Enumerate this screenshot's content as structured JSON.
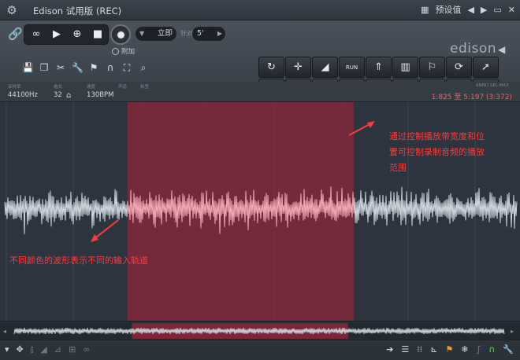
{
  "window": {
    "title": "Edison 试用版 (REC)",
    "preset_label": "预设值"
  },
  "toolbar": {
    "mode_value": "立即",
    "hint_label": "针对",
    "value_field": "5'",
    "addon_label": "附加"
  },
  "logo": {
    "text": "edison"
  },
  "info": {
    "labels": [
      "采样率",
      "格式",
      "速度",
      "声道",
      "标签"
    ],
    "sample_rate": "44100Hz",
    "bits": "32",
    "tempo": "130BPM",
    "selection_label": "ANNO SEL  MAX",
    "selection": "1:825 至 5:197 (3:372)"
  },
  "annotations": {
    "top": [
      "通过控制播放带宽度和位",
      "置可控制录制音频的播放",
      "范围"
    ],
    "left": "不同颜色的波形表示不同的输入轨道"
  },
  "colors": {
    "selection_region": "#8c2738",
    "wave_outside": "#cfd6de",
    "wave_inside": "#f2a9b3",
    "annotation": "#ff3b3b",
    "accent_green": "#8fc93a"
  },
  "waveform": {
    "selection_fraction": [
      0.245,
      0.68
    ]
  }
}
